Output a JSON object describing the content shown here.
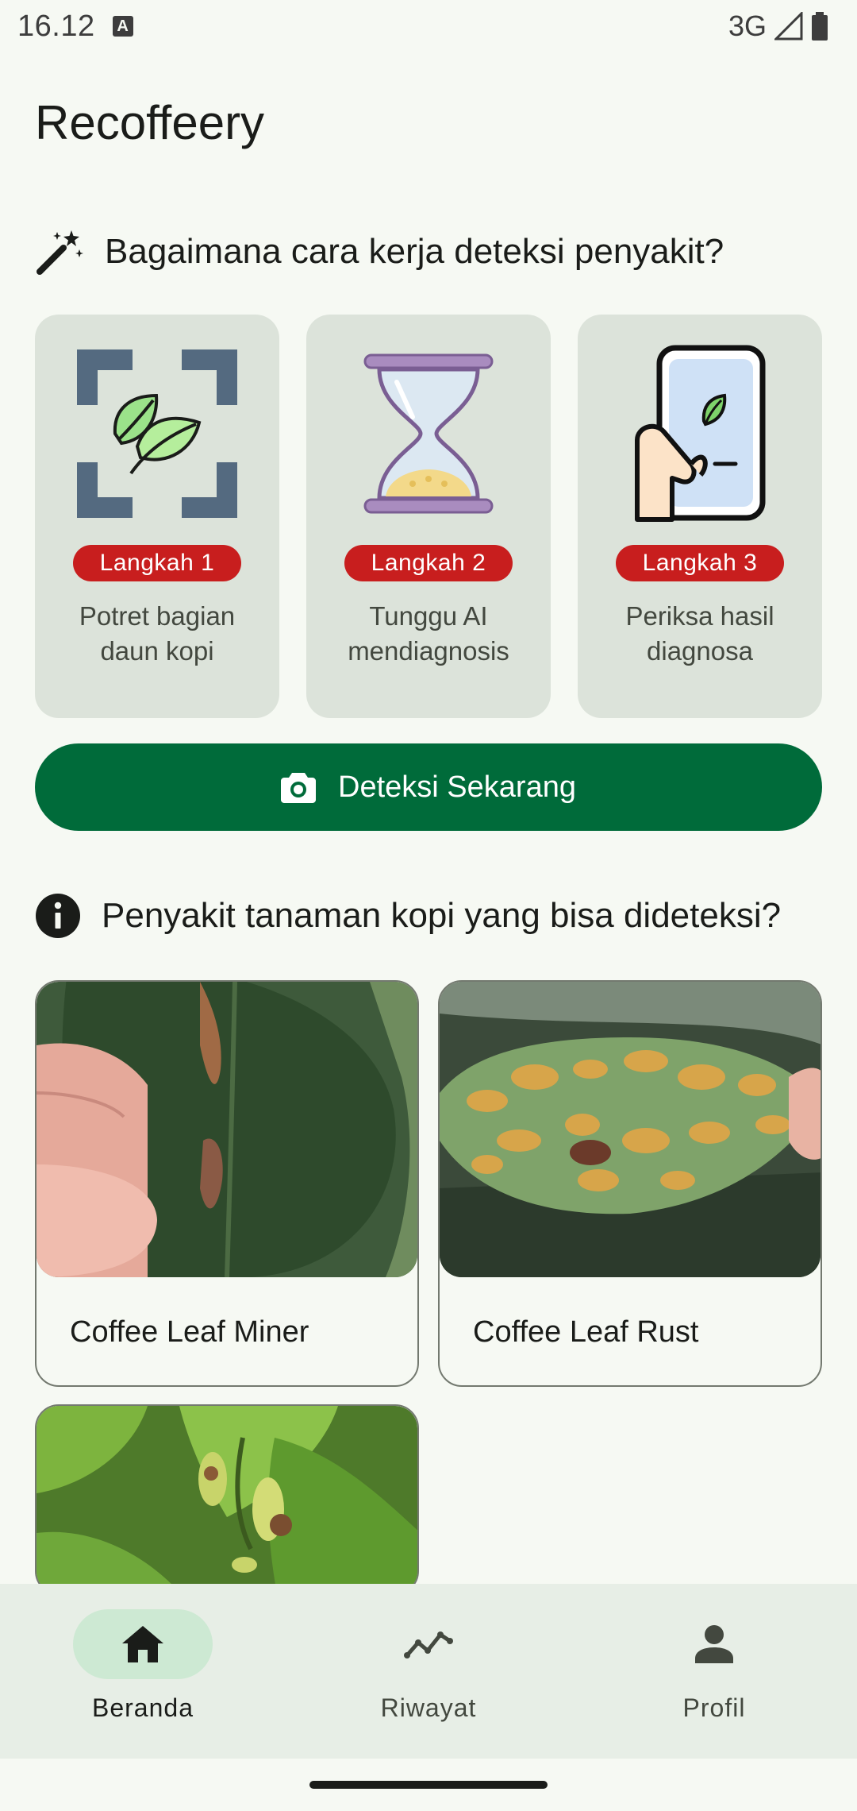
{
  "status_bar": {
    "time": "16.12",
    "network": "3G"
  },
  "app": {
    "title": "Recoffeery"
  },
  "how_it_works": {
    "heading": "Bagaimana cara kerja deteksi penyakit?",
    "steps": [
      {
        "badge": "Langkah 1",
        "text": "Potret bagian daun kopi",
        "icon": "scan-leaf-icon"
      },
      {
        "badge": "Langkah 2",
        "text": "Tunggu AI mendiagnosis",
        "icon": "hourglass-icon"
      },
      {
        "badge": "Langkah 3",
        "text": "Periksa hasil diagnosa",
        "icon": "phone-result-icon"
      }
    ]
  },
  "detect_button": {
    "label": "Deteksi Sekarang",
    "icon": "camera-icon"
  },
  "diseases": {
    "heading": "Penyakit tanaman kopi yang bisa dideteksi?",
    "items": [
      {
        "name": "Coffee Leaf Miner"
      },
      {
        "name": "Coffee Leaf Rust"
      },
      {
        "name": ""
      }
    ]
  },
  "bottom_nav": {
    "items": [
      {
        "label": "Beranda",
        "icon": "home-icon",
        "active": true
      },
      {
        "label": "Riwayat",
        "icon": "trend-icon",
        "active": false
      },
      {
        "label": "Profil",
        "icon": "person-icon",
        "active": false
      }
    ]
  },
  "colors": {
    "primary": "#006B3A",
    "badge": "#C81E1E",
    "card_bg": "#DCE3DA",
    "nav_bg": "#E7EEE6",
    "active_pill": "#CDE9D3"
  }
}
